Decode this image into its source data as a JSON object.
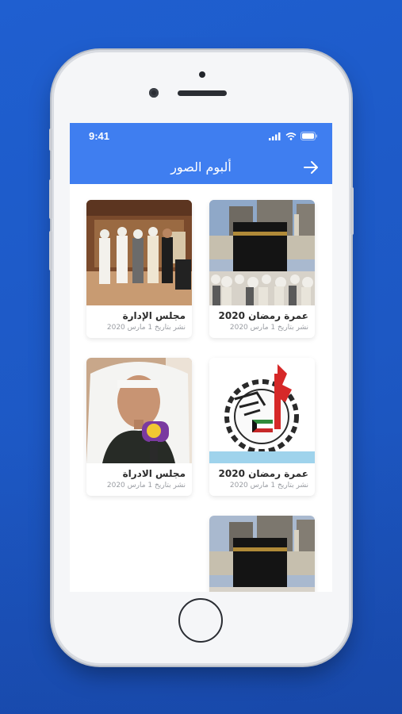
{
  "status": {
    "time": "9:41"
  },
  "appbar": {
    "title": "ألبوم الصور"
  },
  "albums": [
    {
      "title": "عمرة رمضان 2020",
      "date": "نشر بتاريخ 1 مارس 2020",
      "image": "kaaba-photo"
    },
    {
      "title": "مجلس الإدارة",
      "date": "نشر بتاريخ 1 مارس 2020",
      "image": "board-meeting-photo"
    },
    {
      "title": "عمرة رمضان 2020",
      "date": "نشر بتاريخ 1 مارس 2020",
      "image": "union-logo"
    },
    {
      "title": "مجلس الادراة",
      "date": "نشر بتاريخ 1 مارس 2020",
      "image": "interview-photo"
    },
    {
      "title": "",
      "date": "",
      "image": "kaaba-photo"
    }
  ],
  "colors": {
    "primary": "#3f7ef0",
    "background": "#1f5fd0"
  }
}
